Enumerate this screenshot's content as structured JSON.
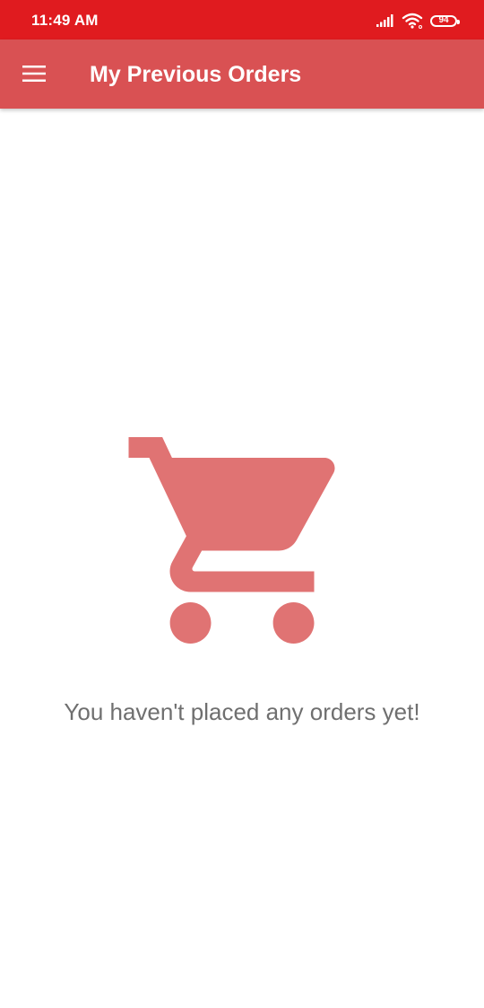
{
  "status_bar": {
    "time": "11:49 AM",
    "battery_level": "94",
    "icons": [
      "signal-icon",
      "wifi-icon",
      "battery-icon"
    ]
  },
  "app_bar": {
    "menu_icon": "hamburger-menu-icon",
    "title": "My Previous Orders"
  },
  "empty_state": {
    "icon": "shopping-cart-icon",
    "message": "You haven't placed any orders yet!"
  },
  "colors": {
    "status_bar": "#e01b1f",
    "app_bar": "#d95153",
    "cart_icon": "#e07373",
    "message_text": "#6f6f6f"
  }
}
